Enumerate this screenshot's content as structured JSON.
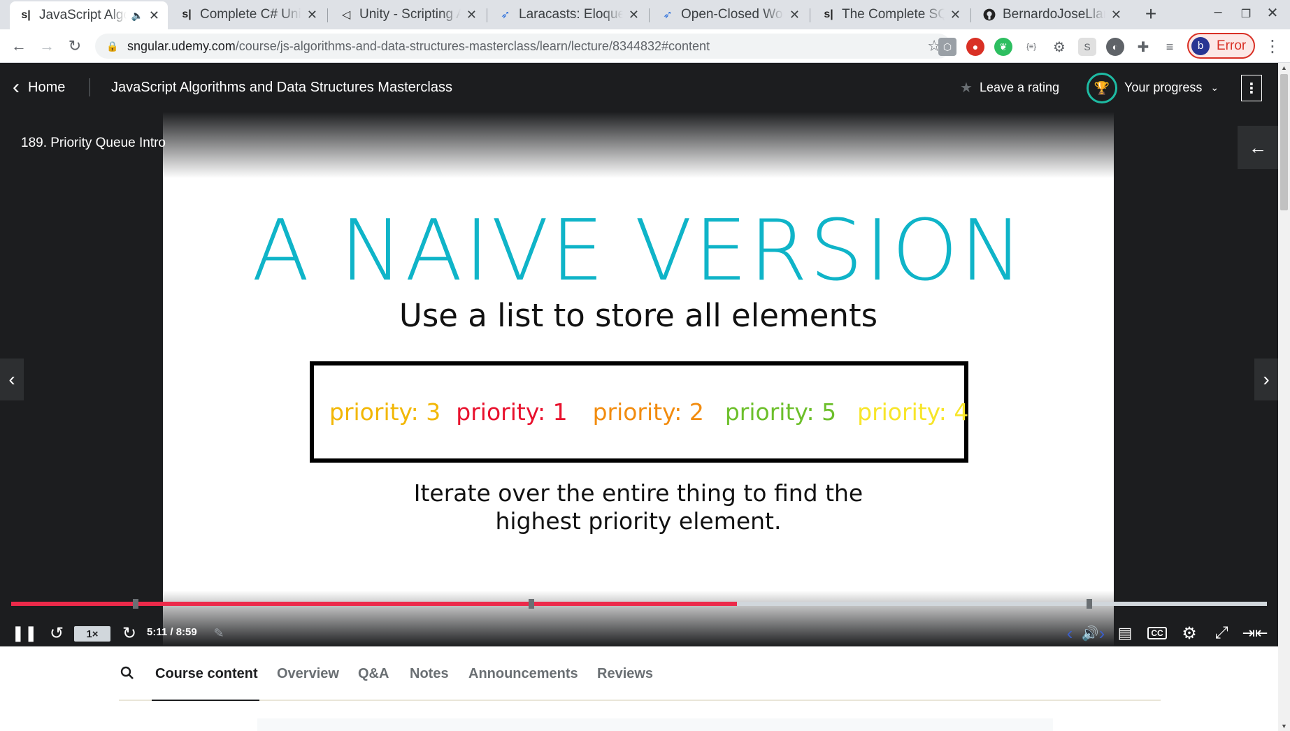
{
  "browser": {
    "tabs": [
      {
        "favicon": "s|",
        "title": "JavaScript Algorithms",
        "active": true,
        "audio": true
      },
      {
        "favicon": "s|",
        "title": "Complete C# Unity"
      },
      {
        "favicon": "unity-icon",
        "title": "Unity - Scripting API"
      },
      {
        "favicon": "laracasts-icon",
        "title": "Laracasts: Eloquent"
      },
      {
        "favicon": "laracasts-icon",
        "title": "Open-Closed World"
      },
      {
        "favicon": "s|",
        "title": "The Complete SQL"
      },
      {
        "favicon": "github-icon",
        "title": "BernardoJoseLlamas"
      }
    ],
    "url_host": "sngular.udemy.com",
    "url_path": "/course/js-algorithms-and-data-structures-masterclass/learn/lecture/8344832#content",
    "profile_initial": "b",
    "profile_status": "Error"
  },
  "header": {
    "home_label": "Home",
    "course_title": "JavaScript Algorithms and Data Structures Masterclass",
    "rating_label": "Leave a rating",
    "progress_label": "Your progress"
  },
  "video": {
    "lecture_title": "189. Priority Queue Intro",
    "slide": {
      "heading": "A NAIVE VERSION",
      "subheading": "Use a list to store all elements",
      "items": [
        {
          "label": "priority: 3",
          "color": "#f2b705"
        },
        {
          "label": "priority: 1",
          "color": "#e8112d"
        },
        {
          "label": "priority: 2",
          "color": "#f28c0f"
        },
        {
          "label": "priority: 5",
          "color": "#6cbf2a"
        },
        {
          "label": "priority: 4",
          "color": "#f7e52a"
        }
      ],
      "description_line1": "Iterate over the entire thing to find the",
      "description_line2": "highest priority element."
    },
    "playback_rate": "1×",
    "time": "5:11 / 8:59",
    "progress_fraction": 0.578,
    "colors": {
      "accent": "#ec2a4a",
      "heading": "#0fb4c8"
    }
  },
  "course_tabs": [
    "Course content",
    "Overview",
    "Q&A",
    "Notes",
    "Announcements",
    "Reviews"
  ]
}
